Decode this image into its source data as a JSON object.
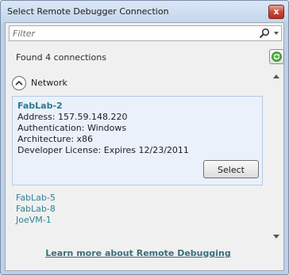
{
  "window": {
    "title": "Select Remote Debugger Connection",
    "close_glyph": "x"
  },
  "filter": {
    "placeholder": "Filter",
    "value": "",
    "icon": "search-icon"
  },
  "status": {
    "found_text": "Found 4 connections"
  },
  "group": {
    "label": "Network",
    "expanded": true
  },
  "selected": {
    "name": "FabLab-2",
    "address": "Address: 157.59.148.220",
    "authentication": "Authentication: Windows",
    "architecture": "Architecture: x86",
    "license": "Developer License: Expires 12/23/2011",
    "select_label": "Select"
  },
  "hosts": [
    "FabLab-5",
    "FabLab-8",
    "JoeVM-1"
  ],
  "footer": {
    "link_text": "Learn more about Remote Debugging"
  },
  "colors": {
    "link": "#2e8597",
    "selected_bg": "#eaf1fa",
    "frame": "#bcd0e8"
  }
}
